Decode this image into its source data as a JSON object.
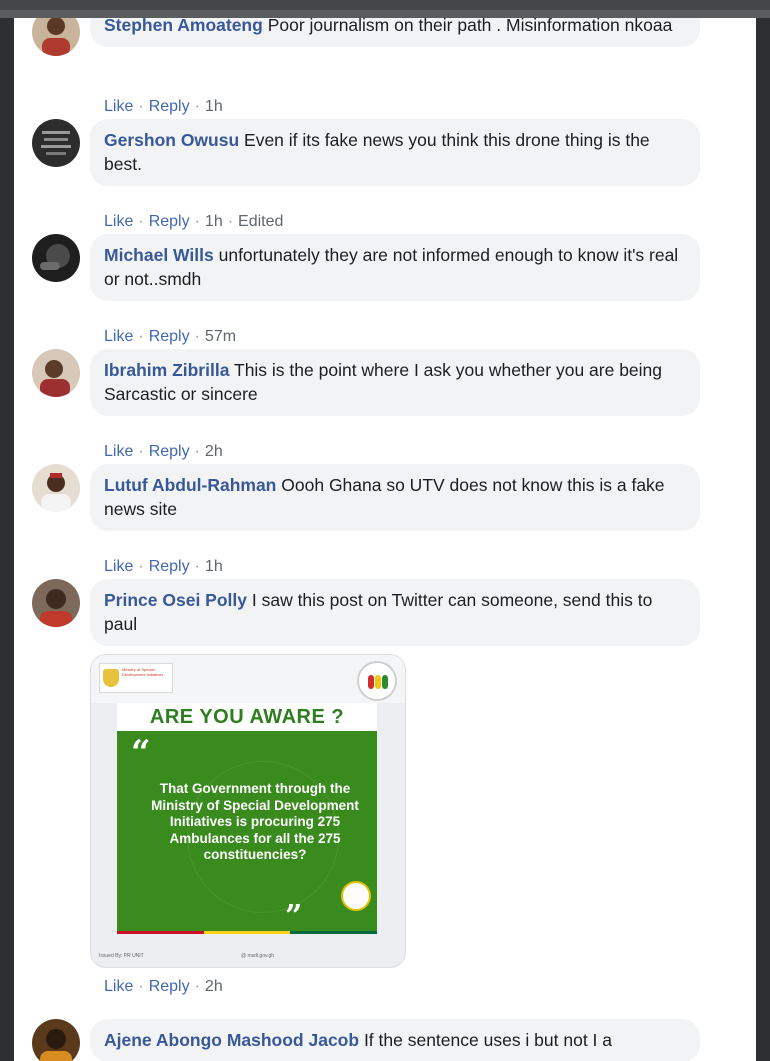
{
  "actions": {
    "like": "Like",
    "reply": "Reply",
    "sep": "·"
  },
  "comments": [
    {
      "author": "Stephen Amoateng",
      "text": "Poor journalism on their path . Misinformation nkoaa",
      "time": "1h",
      "edited": ""
    },
    {
      "author": "Gershon Owusu",
      "text": "Even if its fake news you think this drone thing is the best.",
      "time": "1h",
      "edited": "Edited"
    },
    {
      "author": "Michael Wills",
      "text": "unfortunately they are not informed enough to know it's real or not..smdh",
      "time": "57m",
      "edited": ""
    },
    {
      "author": "Ibrahim Zibrilla",
      "text": "This is the point where I ask you whether you are being Sarcastic or sincere",
      "time": "2h",
      "edited": ""
    },
    {
      "author": "Lutuf Abdul-Rahman",
      "text": "Oooh Ghana so UTV does not know this is a fake news site",
      "time": "1h",
      "edited": ""
    },
    {
      "author": "Prince Osei Polly",
      "text": "I saw this post on Twitter can someone, send this to paul",
      "time": "2h",
      "edited": ""
    },
    {
      "author": "Ajene Abongo Mashood Jacob",
      "text": "If the sentence uses i but not I a",
      "time": "",
      "edited": ""
    }
  ],
  "attachment": {
    "logo_text": "Ministry of Special Development Initiatives",
    "heading": "ARE YOU AWARE ?",
    "open_quote": "“",
    "close_quote": "”",
    "message": "That Government through the Ministry of Special Development Initiatives is procuring 275 Ambulances for all the 275 constituencies?",
    "footer_left": "Issued By: PR UNIT",
    "footer_right": "@ msdi.gov.gh"
  },
  "colors": {
    "author": "#385898",
    "link": "#4267b2",
    "bubble": "#f2f3f5",
    "poster_green": "#3a8b1e",
    "flag_red": "#ce1126",
    "flag_gold": "#fcd116",
    "flag_green": "#006b3f"
  }
}
